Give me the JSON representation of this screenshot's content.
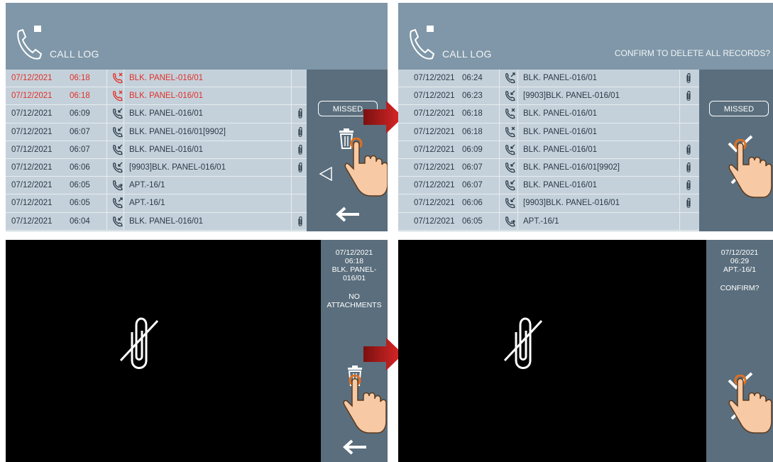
{
  "title": "CALL LOG",
  "confirm_prompt": "CONFIRM TO DELETE ALL RECORDS?",
  "missed_label": "MISSED",
  "colors": {
    "header": "#7f97a8",
    "list": "#c5d1da",
    "side": "#5a6e7d",
    "missed_text": "#e0302a",
    "arrow": "#c81e1e"
  },
  "log_left": [
    {
      "date": "07/12/2021",
      "time": "06:18",
      "type": "missed",
      "name": "BLK. PANEL-016/01",
      "attach": false
    },
    {
      "date": "07/12/2021",
      "time": "06:18",
      "type": "missed",
      "name": "BLK. PANEL-016/01",
      "attach": false
    },
    {
      "date": "07/12/2021",
      "time": "06:09",
      "type": "incoming",
      "name": "BLK. PANEL-016/01",
      "attach": true
    },
    {
      "date": "07/12/2021",
      "time": "06:07",
      "type": "incoming",
      "name": "BLK. PANEL-016/01[9902]",
      "attach": true
    },
    {
      "date": "07/12/2021",
      "time": "06:07",
      "type": "incoming",
      "name": "BLK. PANEL-016/01",
      "attach": true
    },
    {
      "date": "07/12/2021",
      "time": "06:06",
      "type": "incoming",
      "name": "[9903]BLK. PANEL-016/01",
      "attach": true
    },
    {
      "date": "07/12/2021",
      "time": "06:05",
      "type": "forward",
      "name": "APT.-16/1",
      "attach": false
    },
    {
      "date": "07/12/2021",
      "time": "06:05",
      "type": "outgoing",
      "name": "APT.-16/1",
      "attach": false
    },
    {
      "date": "07/12/2021",
      "time": "06:04",
      "type": "incoming",
      "name": "BLK. PANEL-016/01",
      "attach": true
    }
  ],
  "log_right": [
    {
      "date": "07/12/2021",
      "time": "06:24",
      "type": "outgoing",
      "name": "BLK. PANEL-016/01",
      "attach": true
    },
    {
      "date": "07/12/2021",
      "time": "06:23",
      "type": "incoming",
      "name": "[9903]BLK. PANEL-016/01",
      "attach": true
    },
    {
      "date": "07/12/2021",
      "time": "06:18",
      "type": "missed",
      "name": "BLK. PANEL-016/01",
      "attach": false
    },
    {
      "date": "07/12/2021",
      "time": "06:18",
      "type": "missed",
      "name": "BLK. PANEL-016/01",
      "attach": false
    },
    {
      "date": "07/12/2021",
      "time": "06:09",
      "type": "incoming",
      "name": "BLK. PANEL-016/01",
      "attach": true
    },
    {
      "date": "07/12/2021",
      "time": "06:07",
      "type": "incoming",
      "name": "BLK. PANEL-016/01[9902]",
      "attach": true
    },
    {
      "date": "07/12/2021",
      "time": "06:07",
      "type": "incoming",
      "name": "BLK. PANEL-016/01",
      "attach": true
    },
    {
      "date": "07/12/2021",
      "time": "06:06",
      "type": "incoming",
      "name": "[9903]BLK. PANEL-016/01",
      "attach": true
    },
    {
      "date": "07/12/2021",
      "time": "06:05",
      "type": "forward",
      "name": "APT.-16/1",
      "attach": false
    }
  ],
  "detail_left": {
    "date": "07/12/2021",
    "time": "06:18",
    "name": "BLK. PANEL-016/01",
    "status": "NO ATTACHMENTS"
  },
  "detail_right": {
    "date": "07/12/2021",
    "time": "06:29",
    "name": "APT.-16/1",
    "status": "CONFIRM?"
  },
  "icons": [
    "phone-icon",
    "message-icon",
    "trash-icon",
    "back-arrow-icon",
    "prev-icon",
    "check-icon",
    "close-icon",
    "paperclip-icon",
    "no-attachment-icon",
    "hand-pointer-icon",
    "red-arrow-icon"
  ]
}
